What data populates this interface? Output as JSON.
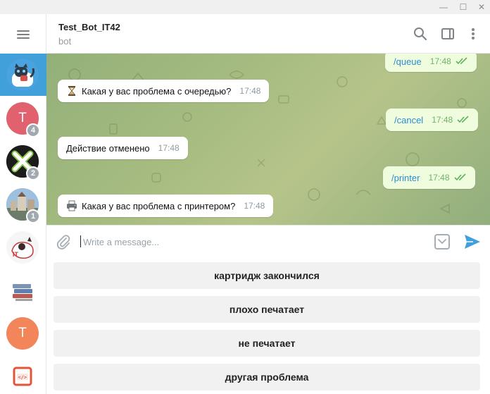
{
  "window": {
    "controls": [
      "—",
      "☐",
      "✕"
    ]
  },
  "chats": [
    {
      "name": "bot-avatar",
      "letter": "",
      "badge": ""
    },
    {
      "name": "t-avatar",
      "letter": "T",
      "badge": "4"
    },
    {
      "name": "x-avatar",
      "letter": "",
      "badge": "2"
    },
    {
      "name": "city-avatar",
      "letter": "",
      "badge": "1"
    },
    {
      "name": "it-cat-avatar",
      "letter": "",
      "badge": ""
    },
    {
      "name": "books-avatar",
      "letter": "",
      "badge": ""
    },
    {
      "name": "t2-avatar",
      "letter": "T",
      "badge": ""
    },
    {
      "name": "code-avatar",
      "letter": "",
      "badge": ""
    }
  ],
  "header": {
    "title": "Test_Bot_IT42",
    "status": "bot"
  },
  "messages": [
    {
      "direction": "out",
      "text": "/queue",
      "time": "17:48"
    },
    {
      "direction": "in",
      "emoji": "hourglass",
      "text": "Какая у вас проблема с очередью?",
      "time": "17:48"
    },
    {
      "direction": "out",
      "text": "/cancel",
      "time": "17:48"
    },
    {
      "direction": "in",
      "text": "Действие отменено",
      "time": "17:48"
    },
    {
      "direction": "out",
      "text": "/printer",
      "time": "17:48"
    },
    {
      "direction": "in",
      "emoji": "printer",
      "text": "Какая у вас проблема с принтером?",
      "time": "17:48"
    }
  ],
  "composer": {
    "placeholder": "Write a message..."
  },
  "keyboard": {
    "buttons": [
      "картридж закончился",
      "плохо печатает",
      "не печатает",
      "другая проблема"
    ]
  },
  "colors": {
    "accent": "#419fd9",
    "outgoing_bubble": "#effdde",
    "incoming_bubble": "#ffffff",
    "link": "#2f8ccf"
  }
}
